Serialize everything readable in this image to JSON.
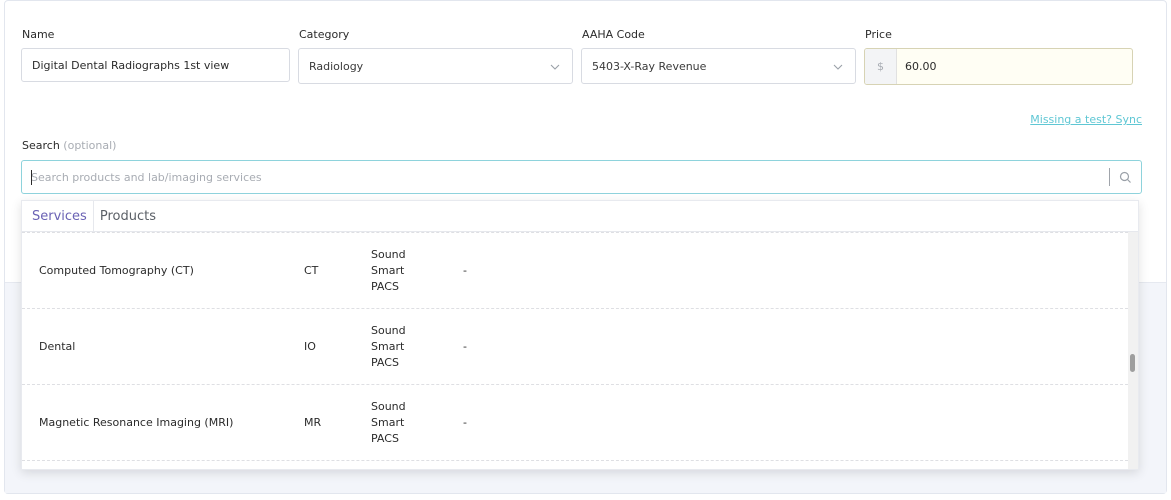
{
  "form": {
    "name": {
      "label": "Name",
      "value": "Digital Dental Radiographs 1st view"
    },
    "category": {
      "label": "Category",
      "value": "Radiology"
    },
    "aaha_code": {
      "label": "AAHA Code",
      "value": "5403-X-Ray Revenue"
    },
    "price": {
      "label": "Price",
      "currency_symbol": "$",
      "value": "60.00"
    }
  },
  "sync_link": "Missing a test? Sync",
  "search": {
    "label": "Search",
    "optional": "(optional)",
    "placeholder": "Search products and lab/imaging services",
    "icon": "search-icon"
  },
  "dropdown": {
    "tabs": [
      {
        "label": "Services",
        "active": true
      },
      {
        "label": "Products",
        "active": false
      }
    ],
    "rows": [
      {
        "name": "Computed Tomography (CT)",
        "code": "CT",
        "vendor": [
          "Sound",
          "Smart",
          "PACS"
        ],
        "extra": "-"
      },
      {
        "name": "Dental",
        "code": "IO",
        "vendor": [
          "Sound",
          "Smart",
          "PACS"
        ],
        "extra": "-"
      },
      {
        "name": "Magnetic Resonance Imaging (MRI)",
        "code": "MR",
        "vendor": [
          "Sound",
          "Smart",
          "PACS"
        ],
        "extra": "-"
      }
    ]
  },
  "colors": {
    "accent_teal": "#5fc7d4",
    "tab_active": "#6a62b4",
    "price_bg": "#fffef4"
  }
}
